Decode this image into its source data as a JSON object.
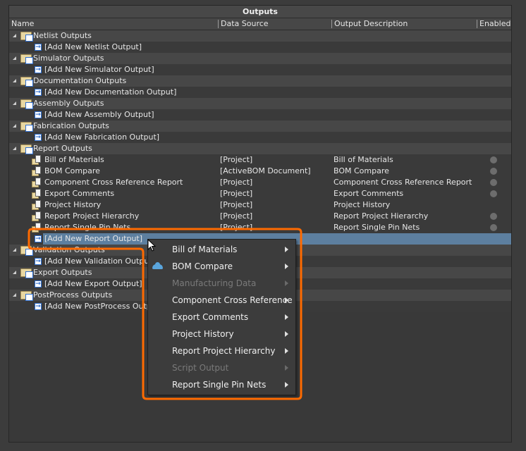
{
  "panel": {
    "title": "Outputs"
  },
  "columns": [
    "Name",
    "Data Source",
    "Output Description",
    "Enabled"
  ],
  "groups": [
    {
      "label": "Netlist Outputs",
      "add": "[Add New Netlist Output]"
    },
    {
      "label": "Simulator Outputs",
      "add": "[Add New Simulator Output]"
    },
    {
      "label": "Documentation Outputs",
      "add": "[Add New Documentation Output]"
    },
    {
      "label": "Assembly Outputs",
      "add": "[Add New Assembly Output]"
    },
    {
      "label": "Fabrication Outputs",
      "add": "[Add New Fabrication Output]"
    },
    {
      "label": "Report Outputs",
      "add": "[Add New Report Output]",
      "items": [
        {
          "name": "Bill of Materials",
          "source": "[Project]",
          "description": "Bill of Materials",
          "enabled": true
        },
        {
          "name": "BOM Compare",
          "source": "[ActiveBOM Document]",
          "description": "BOM Compare",
          "enabled": true
        },
        {
          "name": "Component Cross Reference Report",
          "source": "[Project]",
          "description": "Component Cross Reference Report",
          "enabled": true
        },
        {
          "name": "Export Comments",
          "source": "[Project]",
          "description": "Export Comments",
          "enabled": true
        },
        {
          "name": "Project History",
          "source": "[Project]",
          "description": "Project History",
          "enabled": false
        },
        {
          "name": "Report Project Hierarchy",
          "source": "[Project]",
          "description": "Report Project Hierarchy",
          "enabled": true
        },
        {
          "name": "Report Single Pin Nets",
          "source": "[Project]",
          "description": "Report Single Pin Nets",
          "enabled": true
        }
      ]
    },
    {
      "label": "Validation Outputs",
      "add": "[Add New Validation Output]"
    },
    {
      "label": "Export Outputs",
      "add": "[Add New Export Output]"
    },
    {
      "label": "PostProcess Outputs",
      "add": "[Add New PostProcess Output]"
    }
  ],
  "menu": [
    {
      "label": "Bill of Materials",
      "disabled": false,
      "icon": null
    },
    {
      "label": "BOM Compare",
      "disabled": false,
      "icon": "cloud-icon"
    },
    {
      "label": "Manufacturing Data",
      "disabled": true,
      "icon": null
    },
    {
      "label": "Component Cross Reference",
      "disabled": false,
      "icon": null
    },
    {
      "label": "Export Comments",
      "disabled": false,
      "icon": null
    },
    {
      "label": "Project History",
      "disabled": false,
      "icon": null
    },
    {
      "label": "Report Project Hierarchy",
      "disabled": false,
      "icon": null
    },
    {
      "label": "Script Output",
      "disabled": true,
      "icon": null
    },
    {
      "label": "Report Single Pin Nets",
      "disabled": false,
      "icon": null
    }
  ],
  "colors": {
    "highlight": "#ff6a00",
    "selection": "#5d7f9f"
  }
}
